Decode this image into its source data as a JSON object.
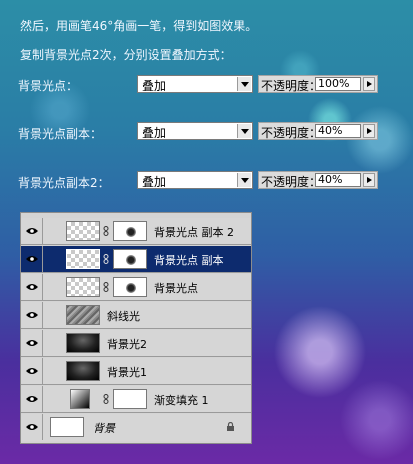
{
  "intro": {
    "line1": "然后，用画笔46°角画一笔，得到如图效果。",
    "line2": "复制背景光点2次，分别设置叠加方式："
  },
  "rows": [
    {
      "label": "背景光点：",
      "blend": "叠加",
      "opacity_label": "不透明度：",
      "opacity": "100%"
    },
    {
      "label": "背景光点副本：",
      "blend": "叠加",
      "opacity_label": "不透明度：",
      "opacity": "40%"
    },
    {
      "label": "背景光点副本2：",
      "blend": "叠加",
      "opacity_label": "不透明度：",
      "opacity": "40%"
    }
  ],
  "layers": [
    {
      "name": "背景光点 副本 2",
      "thumb": "checker",
      "mask": "blob",
      "selected": false
    },
    {
      "name": "背景光点 副本",
      "thumb": "checker",
      "mask": "blob",
      "selected": true
    },
    {
      "name": "背景光点",
      "thumb": "checker",
      "mask": "blob",
      "selected": false
    },
    {
      "name": "斜线光",
      "thumb": "noise",
      "mask": "",
      "selected": false
    },
    {
      "name": "背景光2",
      "thumb": "dark",
      "mask": "",
      "selected": false
    },
    {
      "name": "背景光1",
      "thumb": "dark",
      "mask": "",
      "selected": false
    },
    {
      "name": "渐变填充 1",
      "thumb": "gradient",
      "mask": "white",
      "selected": false
    },
    {
      "name": "背景",
      "thumb": "white",
      "mask": "",
      "selected": false
    }
  ],
  "icons": {
    "eye": "eye-icon",
    "link": "chain-link-icon",
    "lock": "lock-icon",
    "dropdown": "chevron-down-icon",
    "opacity_flyout": "chevron-right-icon"
  },
  "colors": {
    "selected_layer": "#0d2b6e",
    "panel": "#d6d6d6",
    "text": "#f0f7ff"
  }
}
